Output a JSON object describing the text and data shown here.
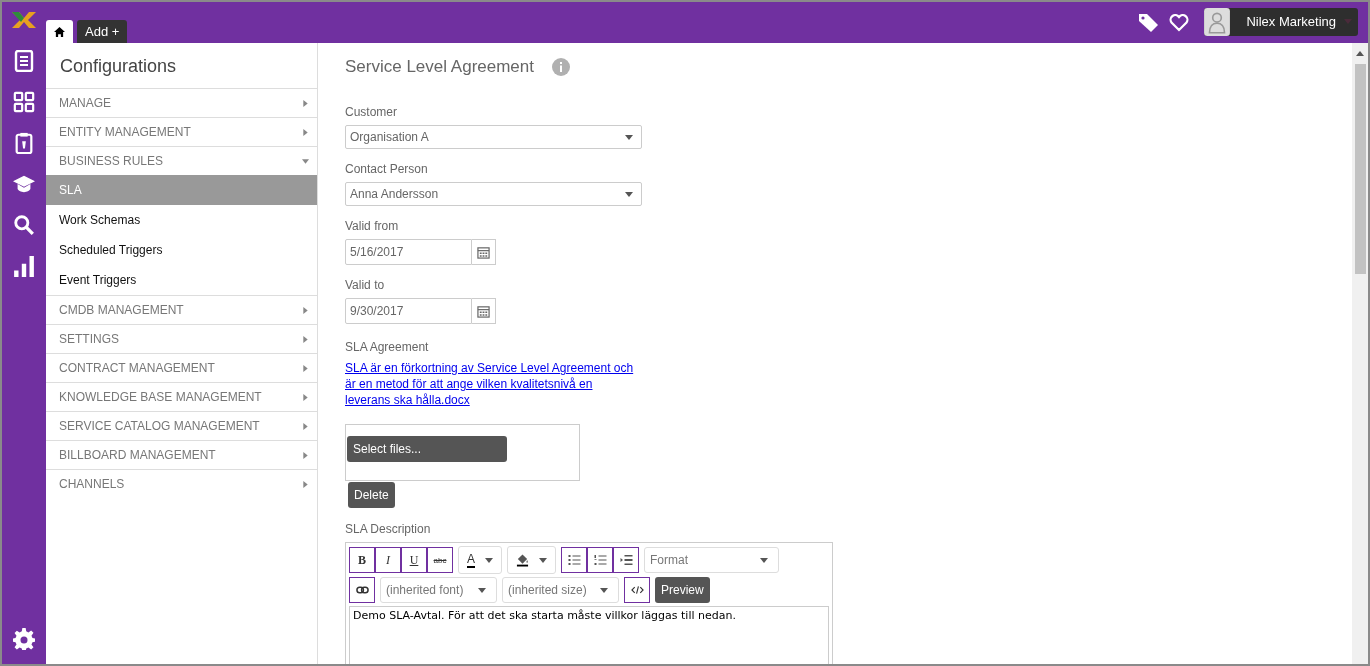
{
  "topbar": {
    "tabs": [
      {
        "kind": "home",
        "selected": true
      },
      {
        "kind": "add",
        "label": "Add +",
        "selected": false
      }
    ],
    "user": {
      "name": "Nilex Marketing"
    }
  },
  "sidebar": {
    "title": "Configurations",
    "items": [
      {
        "label": "MANAGE",
        "expanded": false
      },
      {
        "label": "ENTITY MANAGEMENT",
        "expanded": false
      },
      {
        "label": "BUSINESS RULES",
        "expanded": true,
        "children": [
          {
            "label": "SLA",
            "selected": true
          },
          {
            "label": "Work Schemas",
            "selected": false
          },
          {
            "label": "Scheduled Triggers",
            "selected": false
          },
          {
            "label": "Event Triggers",
            "selected": false
          }
        ]
      },
      {
        "label": "CMDB MANAGEMENT",
        "expanded": false
      },
      {
        "label": "SETTINGS",
        "expanded": false
      },
      {
        "label": "CONTRACT MANAGEMENT",
        "expanded": false
      },
      {
        "label": "KNOWLEDGE BASE MANAGEMENT",
        "expanded": false
      },
      {
        "label": "SERVICE CATALOG MANAGEMENT",
        "expanded": false
      },
      {
        "label": "BILLBOARD MANAGEMENT",
        "expanded": false
      },
      {
        "label": "CHANNELS",
        "expanded": false
      }
    ]
  },
  "form": {
    "title": "Service Level Agreement",
    "fields": [
      {
        "kind": "select",
        "label": "Customer",
        "value": "Organisation A"
      },
      {
        "kind": "select",
        "label": "Contact Person",
        "value": "Anna Andersson"
      },
      {
        "kind": "date",
        "label": "Valid from",
        "value": "5/16/2017"
      },
      {
        "kind": "date",
        "label": "Valid to",
        "value": "9/30/2017"
      }
    ],
    "agreement": {
      "label": "SLA Agreement",
      "link": "SLA är en förkortning av Service Level Agreement och är en metod för att ange vilken kvalitetsnivå en leverans ska hålla.docx",
      "select_button": "Select files...",
      "delete_button": "Delete"
    },
    "description": {
      "label": "SLA Description",
      "style_buttons": [
        "B",
        "I",
        "U",
        "abc"
      ],
      "color_labels": [
        "A"
      ],
      "format": "Format",
      "font": "(inherited font)",
      "size": "(inherited size)",
      "preview_button": "Preview",
      "text": "Demo SLA-Avtal. För att det ska starta måste villkor läggas till nedan."
    }
  }
}
